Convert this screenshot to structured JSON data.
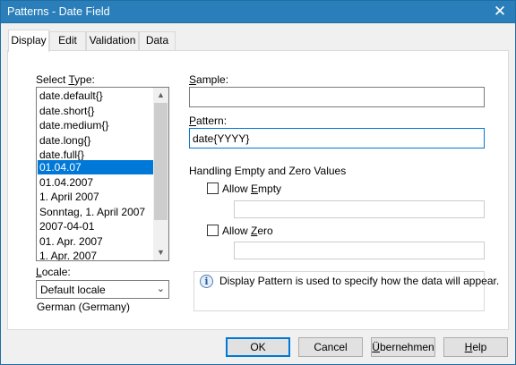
{
  "window": {
    "title": "Patterns - Date Field"
  },
  "tabs": [
    {
      "label": "Display",
      "active": true
    },
    {
      "label": "Edit",
      "active": false
    },
    {
      "label": "Validation",
      "active": false
    },
    {
      "label": "Data",
      "active": false
    }
  ],
  "select_type": {
    "label_pre": "Select ",
    "label_hotkey": "T",
    "label_post": "ype:",
    "items": [
      "date.default{}",
      "date.short{}",
      "date.medium{}",
      "date.long{}",
      "date.full{}",
      "01.04.07",
      "01.04.2007",
      "1. April 2007",
      "Sonntag, 1. April 2007",
      "2007-04-01",
      "01. Apr. 2007",
      "1. Apr. 2007"
    ],
    "selected_index": 5
  },
  "locale": {
    "label_hotkey": "L",
    "label_post": "ocale:",
    "value": "Default locale",
    "description": "German (Germany)"
  },
  "sample": {
    "label_hotkey": "S",
    "label_post": "ample:",
    "value": ""
  },
  "pattern": {
    "label_hotkey": "P",
    "label_post": "attern:",
    "value": "date{YYYY}"
  },
  "handling": {
    "title": "Handling Empty and Zero Values",
    "allow_empty": {
      "label_pre": "Allow ",
      "label_hotkey": "E",
      "label_post": "mpty",
      "checked": false,
      "value": ""
    },
    "allow_zero": {
      "label_pre": "Allow ",
      "label_hotkey": "Z",
      "label_post": "ero",
      "checked": false,
      "value": ""
    }
  },
  "info": {
    "text": "Display Pattern is used to specify how the data will appear."
  },
  "buttons": {
    "ok": "OK",
    "cancel": "Cancel",
    "apply_hotkey": "Ü",
    "apply_post": "bernehmen",
    "help_hotkey": "H",
    "help_post": "elp"
  },
  "colors": {
    "titlebar": "#2a7fba",
    "selection": "#0078d7"
  }
}
